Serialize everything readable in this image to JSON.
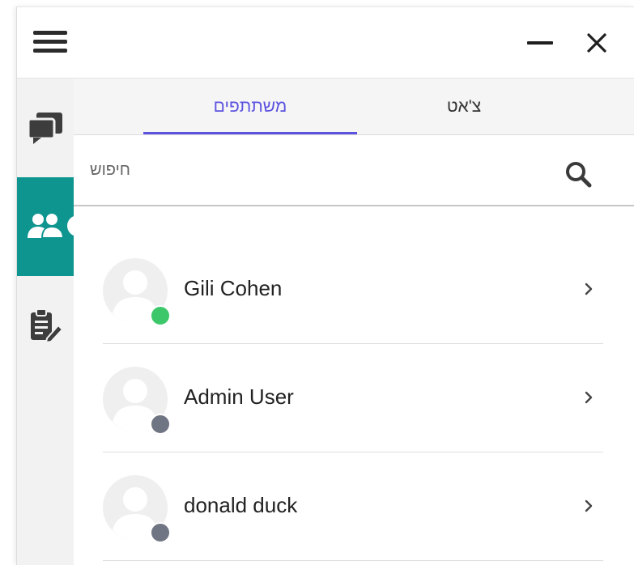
{
  "tabs": {
    "participants": "משתתפים",
    "chat": "צ'אט"
  },
  "search": {
    "placeholder": "חיפוש",
    "value": ""
  },
  "sidebar": {
    "items": [
      {
        "icon": "chat-bubbles-icon",
        "active": false
      },
      {
        "icon": "users-icon",
        "active": true
      },
      {
        "icon": "clipboard-edit-icon",
        "active": false
      }
    ]
  },
  "participants": [
    {
      "name": "Gili Cohen",
      "status": "online",
      "status_color": "#3cc86a"
    },
    {
      "name": "Admin User",
      "status": "offline",
      "status_color": "#6f7582"
    },
    {
      "name": "donald duck",
      "status": "offline",
      "status_color": "#6f7582"
    }
  ],
  "colors": {
    "accent": "#5b53e0",
    "rail_active": "#0e9590",
    "online": "#3cc86a",
    "offline": "#6f7582"
  }
}
